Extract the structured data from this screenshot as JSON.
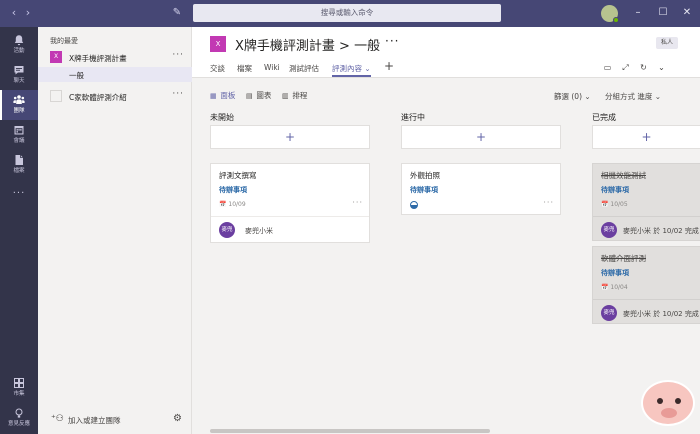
{
  "titlebar": {
    "search_placeholder": "搜尋或輸入命令",
    "back_icon": "‹",
    "forward_icon": "›",
    "compose_icon": "✎",
    "minimize_icon": "–",
    "maximize_icon": "☐",
    "close_icon": "✕"
  },
  "rail": {
    "items": [
      {
        "label": "活動",
        "icon": "bell-icon"
      },
      {
        "label": "聊天",
        "icon": "chat-icon"
      },
      {
        "label": "團隊",
        "icon": "teams-icon"
      },
      {
        "label": "會議",
        "icon": "calendar-icon"
      },
      {
        "label": "檔案",
        "icon": "file-icon"
      },
      {
        "label": "...",
        "icon": "more-icon"
      }
    ],
    "bottom": [
      {
        "label": "市集",
        "icon": "store-icon"
      },
      {
        "label": "意見反應",
        "icon": "feedback-icon"
      }
    ]
  },
  "panel": {
    "heading": "我的最愛",
    "teams": [
      {
        "tile": "X",
        "name": "X牌手機評測計畫",
        "more": "···"
      },
      {
        "tile": "",
        "name": "C家軟體評測介紹",
        "more": "···"
      }
    ],
    "channel": "一般",
    "add_team_label": "加入或建立團隊",
    "add_team_icon": "⁺⚇",
    "settings_icon": "⚙"
  },
  "header": {
    "tile": "X",
    "title": "X牌手機評測計畫 > 一般",
    "more": "···",
    "private_badge": "私人",
    "tabs": [
      "交談",
      "檔案",
      "Wiki",
      "測試評估",
      "評測內容 ⌄"
    ],
    "add_tab": "+",
    "icons": [
      "▭",
      "⤢",
      "↻",
      "⌄"
    ]
  },
  "toolbar": {
    "views": [
      {
        "icon": "▦",
        "label": "面板"
      },
      {
        "icon": "▤",
        "label": "圖表"
      },
      {
        "icon": "▥",
        "label": "排程"
      }
    ],
    "filter_label": "篩選 (0) ⌄",
    "group_label": "分組方式 進度 ⌄"
  },
  "columns": [
    {
      "title": "未開始",
      "add": "+",
      "cards": [
        {
          "title": "評測文撰寫",
          "bucket": "待辦事項",
          "meta": "📅 10/09",
          "more": "···",
          "assignee_initials": "麥兜",
          "assignee": "麥兜小米"
        }
      ]
    },
    {
      "title": "進行中",
      "add": "+",
      "cards": [
        {
          "title": "外觀拍照",
          "bucket": "待辦事項",
          "more": "···",
          "progress": 0.5
        }
      ]
    },
    {
      "title": "已完成",
      "add": "+",
      "cards": [
        {
          "title": "相機效能測試",
          "bucket": "待辦事項",
          "meta": "📅 10/05",
          "assignee_initials": "麥兜",
          "assignee": "麥兜小米 於 10/02 完成"
        },
        {
          "title": "軟體介面評測",
          "bucket": "待辦事項",
          "meta": "📅 10/04",
          "assignee_initials": "麥兜",
          "assignee": "麥兜小米 於 10/02 完成"
        }
      ]
    }
  ]
}
